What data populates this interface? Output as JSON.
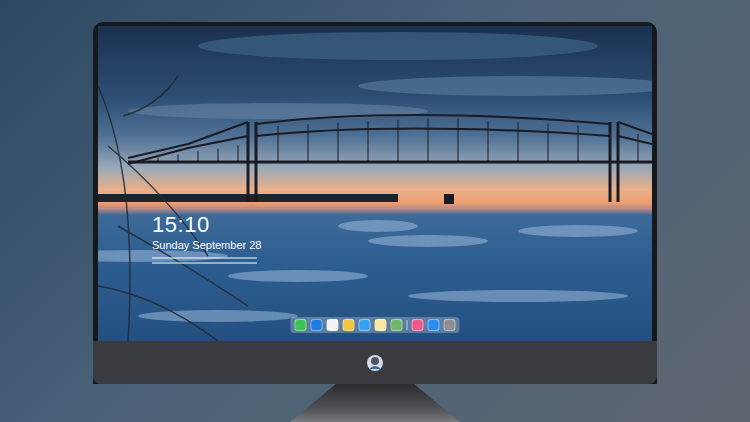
{
  "lock_screen": {
    "time": "15:10",
    "date": "Sunday September 28"
  },
  "dock": {
    "items": [
      {
        "kind": "app",
        "color": "#3ec455"
      },
      {
        "kind": "app",
        "color": "#1e7fe0"
      },
      {
        "kind": "app",
        "color": "#f2f2f2"
      },
      {
        "kind": "app",
        "color": "#f4c542"
      },
      {
        "kind": "app",
        "color": "#3aa0f0"
      },
      {
        "kind": "app",
        "color": "#fbe7a0"
      },
      {
        "kind": "app",
        "color": "#6fb86a"
      },
      {
        "kind": "divider",
        "color": "#ffffff"
      },
      {
        "kind": "app",
        "color": "#f05a8a"
      },
      {
        "kind": "app",
        "color": "#2e8bf0"
      },
      {
        "kind": "app",
        "color": "#8e8e93"
      }
    ]
  }
}
